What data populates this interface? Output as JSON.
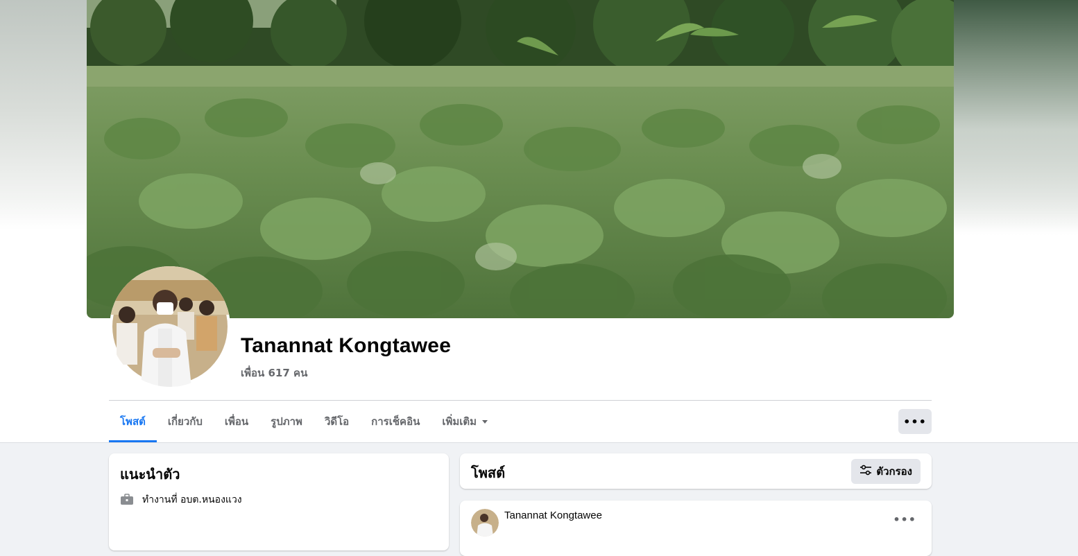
{
  "profile": {
    "name": "Tanannat Kongtawee",
    "friends_text": "เพื่อน 617 คน"
  },
  "tabs": [
    {
      "label": "โพสต์",
      "active": true
    },
    {
      "label": "เกี่ยวกับ",
      "active": false
    },
    {
      "label": "เพื่อน",
      "active": false
    },
    {
      "label": "รูปภาพ",
      "active": false
    },
    {
      "label": "วิดีโอ",
      "active": false
    },
    {
      "label": "การเช็คอิน",
      "active": false
    },
    {
      "label": "เพิ่มเติม",
      "active": false
    }
  ],
  "more_button": {
    "label": "•••"
  },
  "intro": {
    "title": "แนะนำตัว",
    "items": [
      {
        "icon": "briefcase-icon",
        "text": "ทำงานที่ อบต.หนองแวง"
      }
    ]
  },
  "posts_header": {
    "title": "โพสต์",
    "filter_label": "ตัวกรอง",
    "filter_icon": "sliders-icon"
  },
  "post": {
    "author": "Tanannat Kongtawee",
    "more_label": "•••"
  },
  "colors": {
    "accent": "#1877f2",
    "muted_text": "#65676b",
    "page_bg": "#f0f2f5",
    "button_bg": "#e4e6eb"
  }
}
